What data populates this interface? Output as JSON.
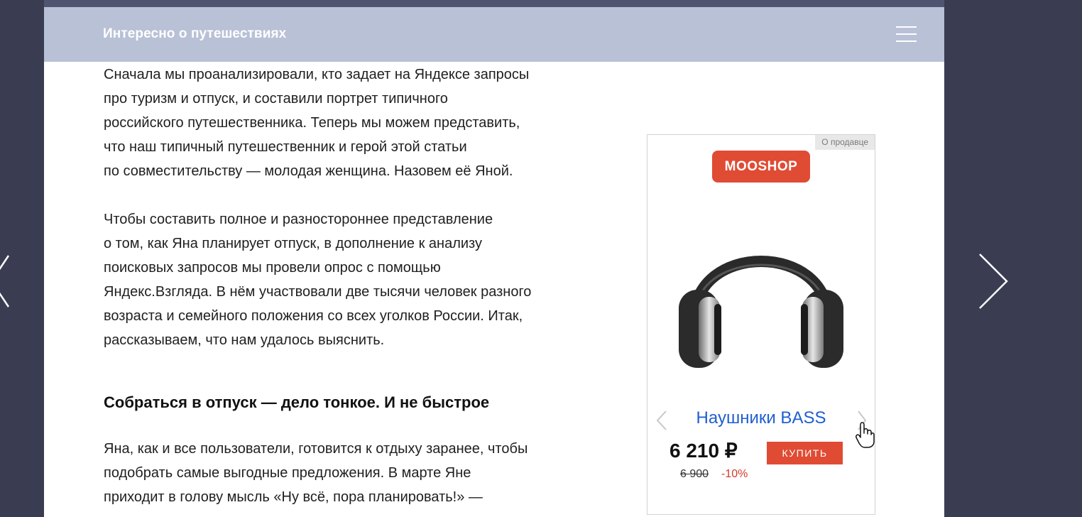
{
  "header": {
    "site_title": "Интересно о путешествиях"
  },
  "article": {
    "paragraph1": [
      "Сначала мы проанализировали, кто задает на Яндексе запросы",
      "про туризм и отпуск, и составили портрет типичного",
      "российского путешественника. Теперь мы можем представить,",
      "что наш типичный путешественник и герой этой статьи",
      "по совместительству — молодая женщина. Назовем её Яной."
    ],
    "paragraph2": [
      "Чтобы составить полное и разностороннее представление",
      "о том, как Яна планирует отпуск, в дополнение к анализу",
      "поисковых запросов мы провели опрос с помощью",
      "Яндекс.Взгляда. В нём участвовали две тысячи человек разного",
      "возраста и семейного положения со всех уголков России. Итак,",
      "рассказываем, что нам удалось выяснить."
    ],
    "heading": "Собраться в отпуск — дело тонкое. И не быстрое",
    "paragraph3": [
      "Яна, как и все пользователи, готовится к отдыху заранее, чтобы",
      "подобрать самые выгодные предложения. В марте Яне",
      "приходит в голову мысль «Ну всё, пора планировать!» —"
    ]
  },
  "ad": {
    "seller_label": "О продавце",
    "shop_name": "MOOSHOP",
    "product_name": "Наушники BASS",
    "price": "6 210 ₽",
    "old_price": "6 900",
    "discount": "-10%",
    "buy_label": "КУПИТЬ",
    "image_icon": "headphones-icon",
    "accent_color": "#e04b34",
    "link_color": "#1f5fcf"
  },
  "colors": {
    "header_bg": "#b8c1d6",
    "page_bg": "#3a3d52"
  }
}
